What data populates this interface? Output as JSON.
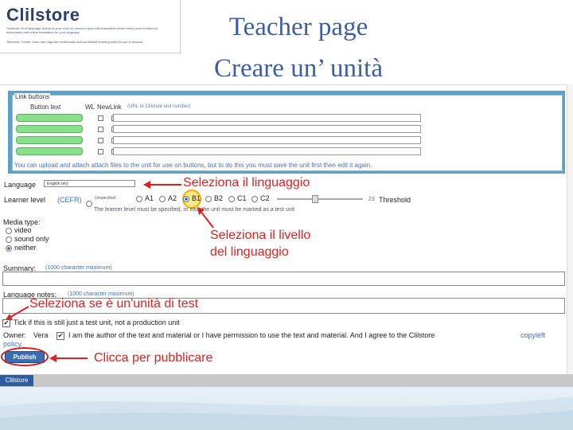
{
  "slide": {
    "title_line1": "Teacher page",
    "title_line2": "Creare un’ unità"
  },
  "logo": {
    "text": "Clilstore",
    "note1": "Students: Find language videos at your level on various topics with transcripts where every word is linked to dictionaries and online translators for your language",
    "note2": "Teachers: Create, store and organise multimedia and wordlinked learning units for use in lessons"
  },
  "link_buttons": {
    "legend": "Link buttons",
    "col_button_text": "Button text",
    "col_wl": "WL",
    "col_new": "New",
    "col_link": "Link",
    "col_link_note": "(URL or Clilstore unit number)",
    "rows": [
      "",
      "",
      "",
      ""
    ],
    "upload_note": "You can upload and attach attach files to the unit for use on buttons, but to do this you must save the unit first then edit it again."
  },
  "language": {
    "label": "Language",
    "selected": "English (en)"
  },
  "learner_level": {
    "label": "Learner level",
    "cefr_link": "(CEFR)",
    "unspecified": "Unspecified",
    "levels": [
      "A1",
      "A2",
      "B1",
      "B2",
      "C1",
      "C2"
    ],
    "selected": "B1",
    "threshold_value": "23",
    "threshold_label": "Threshold",
    "threshold_fraction": 0.42,
    "note": "The learner level must be specified, or else the unit must be marked as a test unit"
  },
  "media_type": {
    "label": "Media type:",
    "options": [
      "video",
      "sound only",
      "neither"
    ],
    "selected": "neither"
  },
  "summary": {
    "label": "Summary:",
    "note": "(1000 character maximum)"
  },
  "language_notes": {
    "label": "Language notes:",
    "note": "(1000 character maximum)"
  },
  "test_unit": {
    "label": "Tick if this is still just a test unit, not a production unit",
    "checked": true
  },
  "owner": {
    "label": "Owner:",
    "name": "Vera",
    "agree_text": "I am the author of the text and material or I have permission to use the text and material. And I agree to the Clilstore",
    "copyleft_link": "copyleft",
    "policy_link": "policy."
  },
  "publish": {
    "label": "Publish"
  },
  "footer": {
    "label": "Clilstore"
  },
  "annotations": {
    "language": "Seleziona il linguaggio",
    "level_line1": "Seleziona il livello",
    "level_line2": "del linguaggio",
    "test": "Seleziona se è un'unità di test",
    "publish": "Clicca per pubblicare"
  },
  "colors": {
    "title": "#3d5fa0",
    "annotation": "#e02020",
    "panel_border": "#5ea0c8",
    "button_green": "#88e08a",
    "publish_blue": "#3a6db4"
  }
}
